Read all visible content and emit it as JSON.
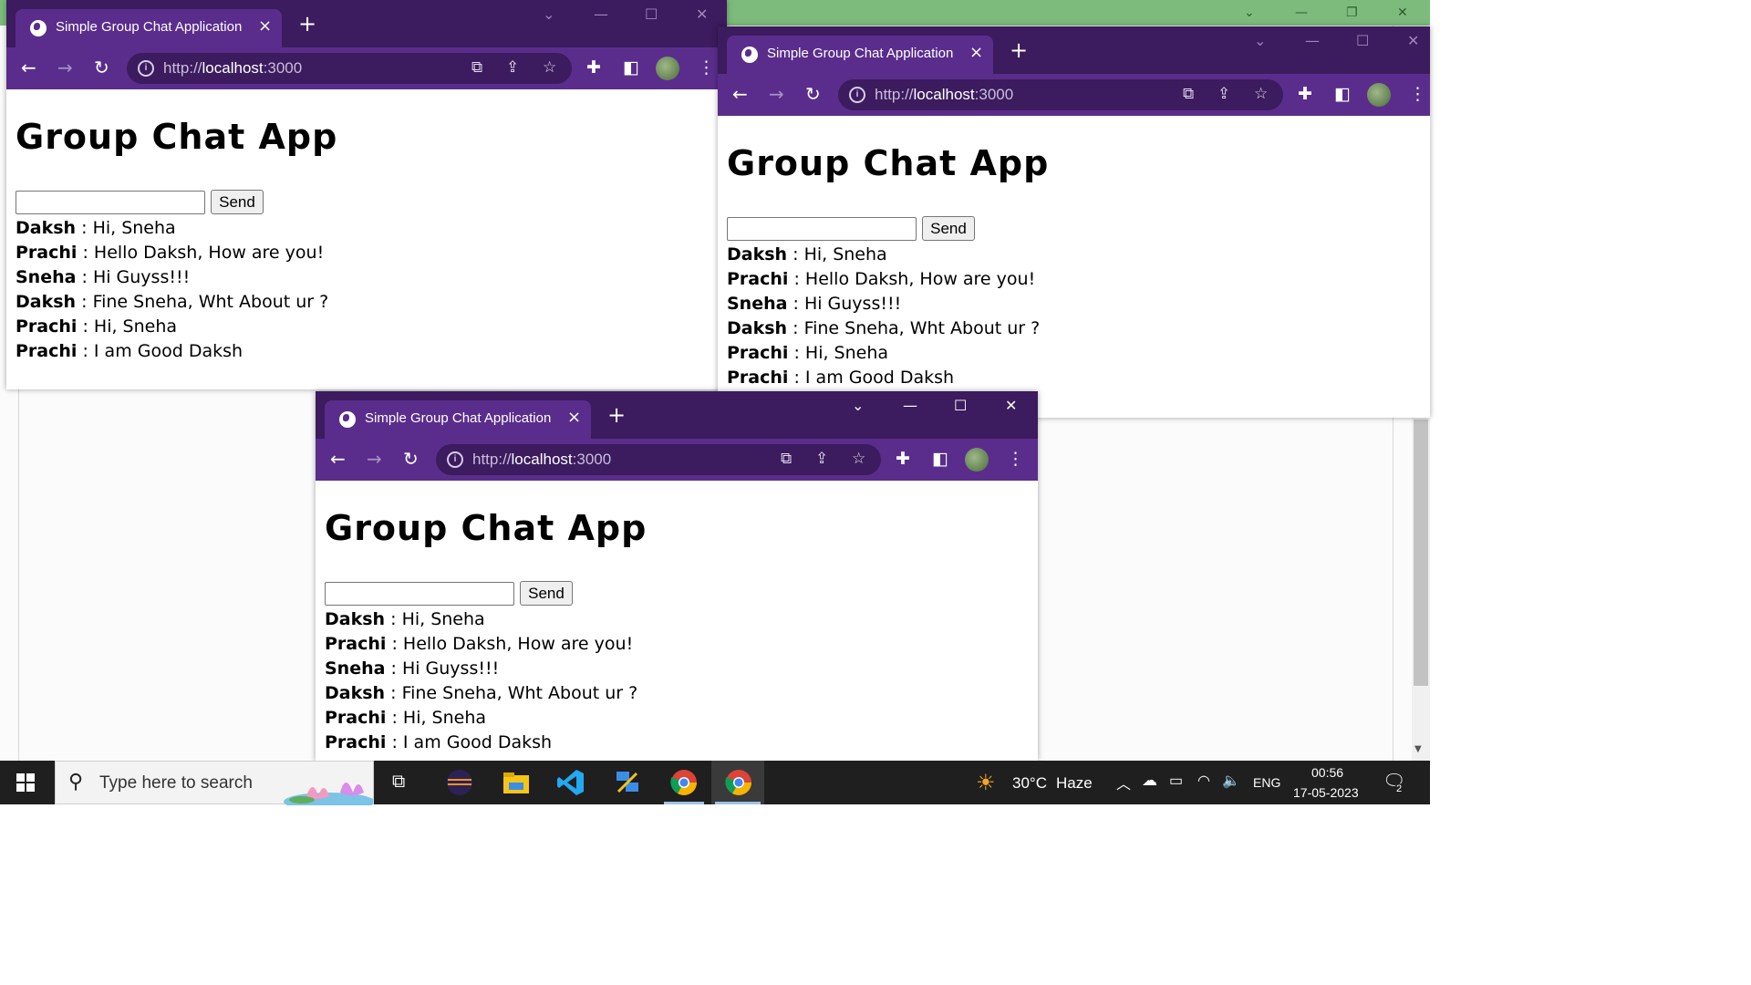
{
  "browser": {
    "tab_title": "Simple Group Chat Application",
    "tab_close": "×",
    "new_tab": "+",
    "url_prefix": "http://",
    "url_host": "localhost",
    "url_port": ":3000",
    "accent_color": "#5a2d8c"
  },
  "page": {
    "heading": "Group Chat App",
    "input_value": "",
    "send_label": "Send",
    "separator": " : ",
    "messages": [
      {
        "user": "Daksh",
        "text": "Hi, Sneha"
      },
      {
        "user": "Prachi",
        "text": "Hello Daksh, How are you!"
      },
      {
        "user": "Sneha",
        "text": "Hi Guyss!!!"
      },
      {
        "user": "Daksh",
        "text": "Fine Sneha, Wht About ur ?"
      },
      {
        "user": "Prachi",
        "text": "Hi, Sneha"
      },
      {
        "user": "Prachi",
        "text": "I am Good Daksh"
      }
    ]
  },
  "taskbar": {
    "search_placeholder": "Type here to search",
    "weather_temp": "30°C",
    "weather_desc": "Haze",
    "language": "ENG",
    "time": "00:56",
    "date": "17-05-2023",
    "notifications": "2"
  }
}
